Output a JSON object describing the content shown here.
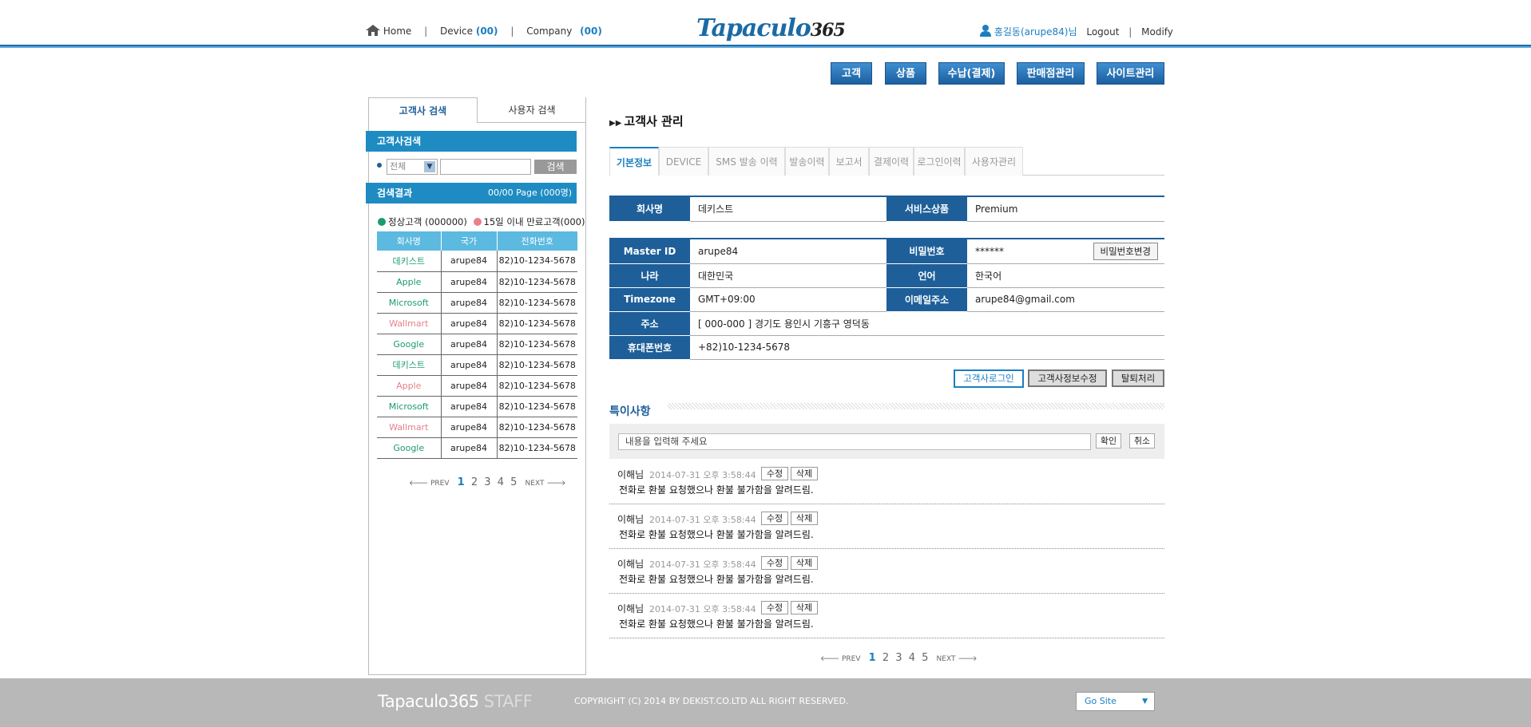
{
  "topnav": {
    "home": "Home",
    "device": "Device",
    "device_count": "(00)",
    "company": "Company",
    "company_count": "(00)",
    "sep": "|"
  },
  "logo": {
    "text": "Tapaculo",
    "digits": "365"
  },
  "user": {
    "name": "홍길동(arupe84)님",
    "logout": "Logout",
    "modify": "Modify"
  },
  "menu": [
    "고객",
    "상품",
    "수납(결제)",
    "판매점관리",
    "사이트관리"
  ],
  "left": {
    "tab1": "고객사 검색",
    "tab2": "사용자 검색",
    "search_title": "고객사검색",
    "select": "전체",
    "search_btn": "검색",
    "result_title": "검색결과",
    "result_page": "00/00 Page (000명)",
    "legend_normal": "정상고객 (000000)",
    "legend_expire": "15일 이내 만료고객(000)",
    "headers": [
      "회사명",
      "국가",
      "전화번호"
    ],
    "rows": [
      [
        "데키스트",
        "arupe84",
        "82)10-1234-5678"
      ],
      [
        "Apple",
        "arupe84",
        "82)10-1234-5678"
      ],
      [
        "Microsoft",
        "arupe84",
        "82)10-1234-5678"
      ],
      [
        "Wallmart",
        "arupe84",
        "82)10-1234-5678"
      ],
      [
        "Google",
        "arupe84",
        "82)10-1234-5678"
      ],
      [
        "데키스트",
        "arupe84",
        "82)10-1234-5678"
      ],
      [
        "Apple",
        "arupe84",
        "82)10-1234-5678"
      ],
      [
        "Microsoft",
        "arupe84",
        "82)10-1234-5678"
      ],
      [
        "Wallmart",
        "arupe84",
        "82)10-1234-5678"
      ],
      [
        "Google",
        "arupe84",
        "82)10-1234-5678"
      ]
    ],
    "row_status": [
      "normal",
      "normal",
      "normal",
      "expire",
      "normal",
      "normal",
      "expire",
      "normal",
      "expire",
      "normal"
    ]
  },
  "pager": {
    "prev": "PREV",
    "next": "NEXT",
    "pages": [
      "1",
      "2",
      "3",
      "4",
      "5"
    ]
  },
  "main": {
    "title": "고객사 관리",
    "tabs": [
      "기본정보",
      "DEVICE",
      "SMS 발송 이력",
      "발송이력",
      "보고서",
      "결제이력",
      "로그인이력",
      "사용자관리"
    ],
    "company_label": "회사명",
    "company": "데키스트",
    "service_label": "서비스상품",
    "service": "Premium",
    "master_label": "Master ID",
    "master": "arupe84",
    "pw_label": "비밀번호",
    "pw": "******",
    "pw_btn": "비밀번호변경",
    "country_label": "나라",
    "country": "대한민국",
    "lang_label": "언어",
    "lang": "한국어",
    "tz_label": "Timezone",
    "tz": "GMT+09:00",
    "email_label": "이메일주소",
    "email": "arupe84@gmail.com",
    "addr_label": "주소",
    "addr": "[ 000-000 ] 경기도 용인시 기흥구 영덕동",
    "phone_label": "휴대폰번호",
    "phone": "+82)10-1234-5678",
    "btn_login": "고객사로그인",
    "btn_edit": "고객사정보수정",
    "btn_leave": "탈퇴처리",
    "notes_title": "특이사항",
    "note_placeholder": "내용을 입력해 주세요",
    "ok": "확인",
    "cancel": "취소",
    "comments": [
      {
        "author": "이해님",
        "date": "2014-07-31 오후 3:58:44",
        "edit": "수정",
        "del": "삭제",
        "text": "전화로 환불 요청했으나 환불 불가함을 알려드림."
      },
      {
        "author": "이해님",
        "date": "2014-07-31 오후 3:58:44",
        "edit": "수정",
        "del": "삭제",
        "text": "전화로 환불 요청했으나 환불 불가함을 알려드림."
      },
      {
        "author": "이해님",
        "date": "2014-07-31 오후 3:58:44",
        "edit": "수정",
        "del": "삭제",
        "text": "전화로 환불 요청했으나 환불 불가함을 알려드림."
      },
      {
        "author": "이해님",
        "date": "2014-07-31 오후 3:58:44",
        "edit": "수정",
        "del": "삭제",
        "text": "전화로 환불 요청했으나 환불 불가함을 알려드림."
      }
    ]
  },
  "footer": {
    "logo": "Tapaculo365",
    "staff": "STAFF",
    "copyright": "COPYRIGHT (C) 2014 BY DEKIST.CO.LTD ALL RIGHT RESERVED.",
    "gosite": "Go Site"
  },
  "colors": {
    "brand": "#1e5f99",
    "accent": "#1e8bc3",
    "normal": "#1c9b6b",
    "expire": "#e8808a"
  }
}
